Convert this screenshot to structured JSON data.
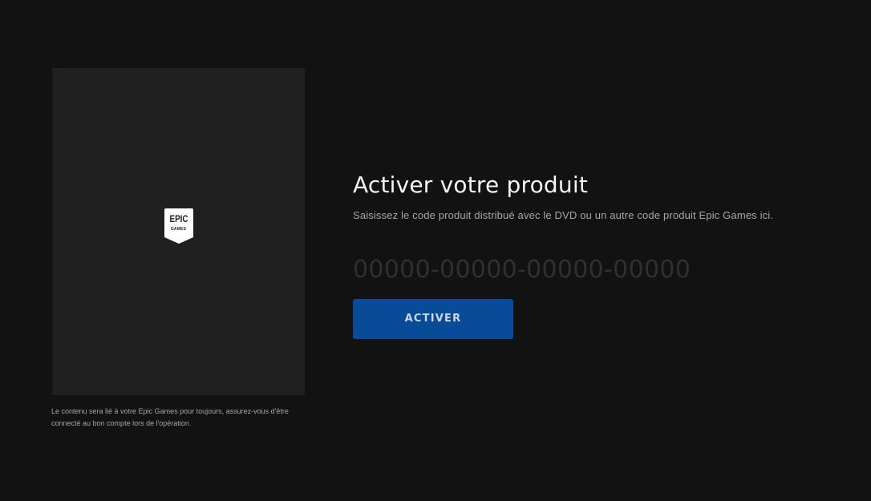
{
  "product": {
    "logo": {
      "icon": "epic-games-logo",
      "text_main": "EPIC",
      "text_sub": "GAMES"
    },
    "disclaimer": "Le contenu sera lié à votre Epic Games pour toujours, assurez-vous d'être connecté au bon compte lors de l'opération."
  },
  "activation": {
    "title": "Activer votre produit",
    "subtitle": "Saisissez le code produit distribué avec le DVD ou un autre code produit Epic Games ici.",
    "code_input": {
      "value": "",
      "placeholder": "00000-00000-00000-00000"
    },
    "activate_label": "ACTIVER"
  },
  "colors": {
    "background": "#121212",
    "panel": "#202020",
    "accent": "#074b99"
  }
}
